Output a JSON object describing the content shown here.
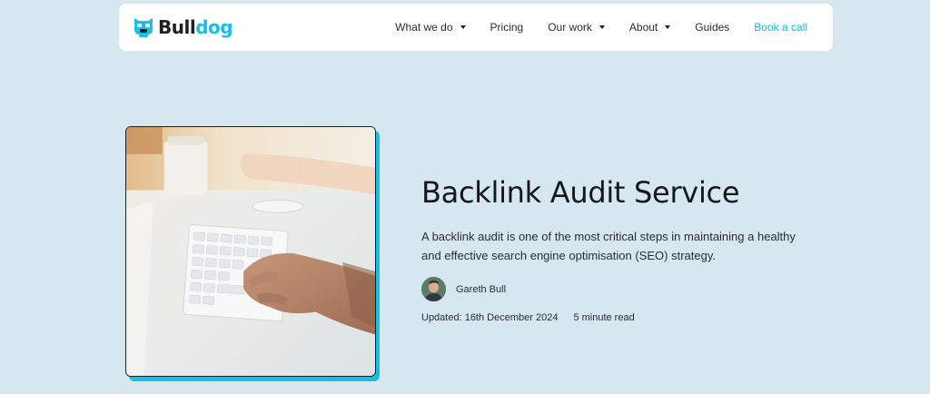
{
  "header": {
    "logo": {
      "text_dark": "Bull",
      "text_accent": "dog",
      "icon": "bulldog-mascot-icon"
    },
    "nav": [
      {
        "label": "What we do",
        "dropdown": true
      },
      {
        "label": "Pricing",
        "dropdown": false
      },
      {
        "label": "Our work",
        "dropdown": true
      },
      {
        "label": "About",
        "dropdown": true
      },
      {
        "label": "Guides",
        "dropdown": false
      }
    ],
    "cta": "Book a call"
  },
  "hero": {
    "title": "Backlink Audit Service",
    "description": "A backlink audit is one of the most critical steps in maintaining a healthy and effective search engine optimisation (SEO) strategy.",
    "author": {
      "name": "Gareth Bull",
      "avatar_icon": "author-avatar"
    },
    "updated": "Updated: 16th December 2024",
    "read_time": "5 minute read",
    "image_icon": "keyboard-typing-photo"
  },
  "colors": {
    "page_background": "#d6e7ef",
    "accent": "#16c0e8",
    "text": "#1c1f23"
  }
}
